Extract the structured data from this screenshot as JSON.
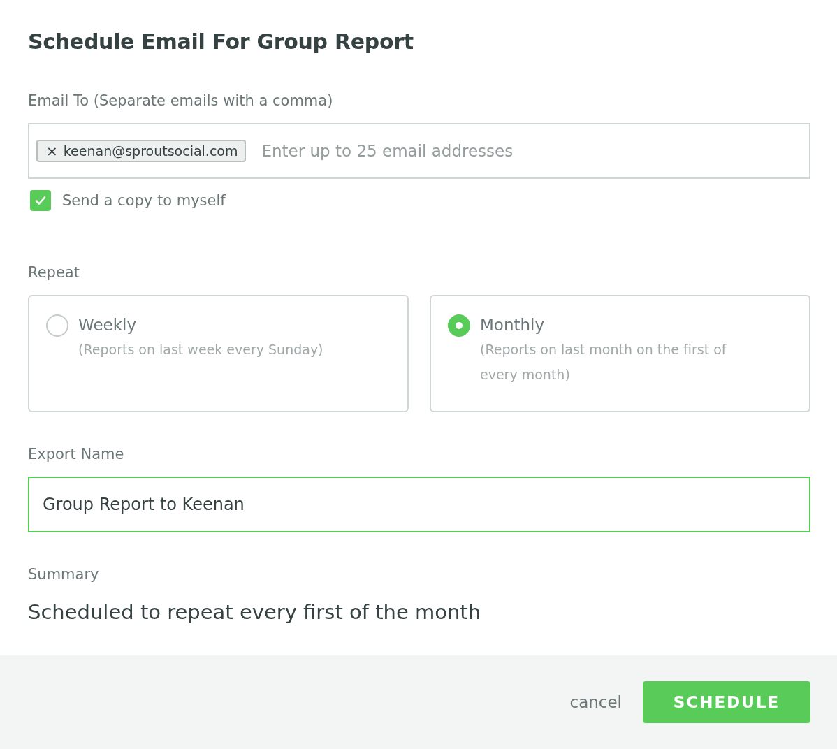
{
  "title": "Schedule Email For Group Report",
  "email_to": {
    "label": "Email To (Separate emails with a comma)",
    "tags": [
      {
        "remove": "×",
        "text": "keenan@sproutsocial.com"
      }
    ],
    "placeholder": "Enter up to 25 email addresses"
  },
  "copy_to_self": {
    "label": "Send a copy to myself",
    "checked": true
  },
  "repeat": {
    "label": "Repeat",
    "options": [
      {
        "title": "Weekly",
        "description": "(Reports on last week every Sunday)",
        "selected": false
      },
      {
        "title": "Monthly",
        "description": "(Reports on last month on the first of every month)",
        "selected": true
      }
    ]
  },
  "export_name": {
    "label": "Export Name",
    "value": "Group Report to Keenan",
    "focused": true
  },
  "summary": {
    "label": "Summary",
    "text": "Scheduled to repeat every first of the month"
  },
  "footer": {
    "cancel": "cancel",
    "submit": "SCHEDULE"
  }
}
